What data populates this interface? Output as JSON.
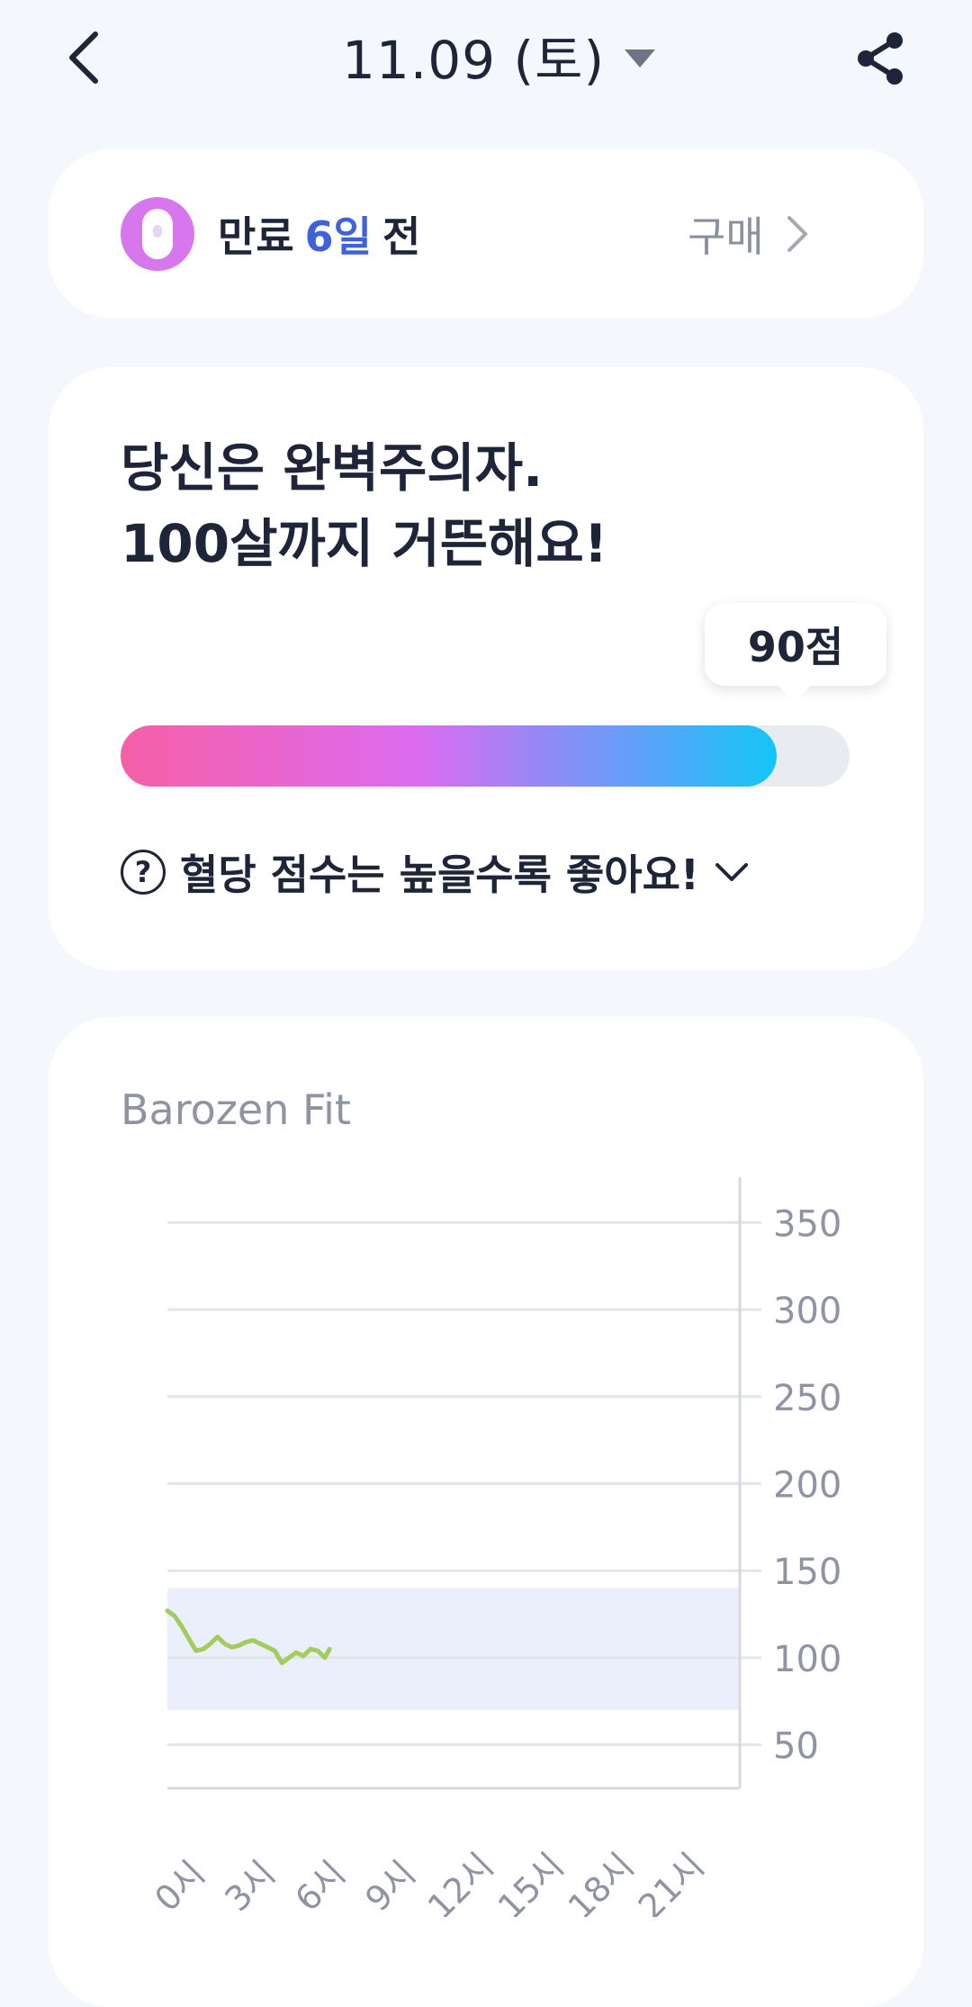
{
  "header": {
    "date": "11.09 (토)",
    "back_icon": "back-chevron-icon",
    "share_icon": "share-icon"
  },
  "expiry": {
    "prefix": "만료",
    "days": "6일",
    "suffix": "전",
    "buy_label": "구매",
    "icon": "pill-icon",
    "icon_color": "#d677ee"
  },
  "score": {
    "title_line1": "당신은 완벽주의자.",
    "title_line2": "100살까지 거뜬해요!",
    "value_label": "90점",
    "value": 90,
    "max": 100,
    "help_text": "혈당 점수는 높을수록 좋아요!",
    "gradient": [
      "#f65fa6",
      "#dd6bf0",
      "#5ba2fb",
      "#14c6f5"
    ]
  },
  "chart_data": {
    "type": "line",
    "title": "Barozen Fit",
    "x_tick_labels": [
      "0시",
      "3시",
      "6시",
      "9시",
      "12시",
      "15시",
      "18시",
      "21시"
    ],
    "y_ticks": [
      50,
      100,
      150,
      200,
      250,
      300,
      350
    ],
    "ylim": [
      25,
      375
    ],
    "xlim": [
      0,
      24
    ],
    "y_axis_position": "right",
    "grid": true,
    "target_range": [
      70,
      140
    ],
    "series": [
      {
        "color": "#a2cd5e",
        "x": [
          0,
          0.3,
          0.6,
          0.9,
          1.2,
          1.5,
          1.8,
          2.1,
          2.4,
          2.7,
          3.0,
          3.3,
          3.6,
          3.9,
          4.2,
          4.5,
          4.8,
          5.1,
          5.4,
          5.7,
          6.0,
          6.3,
          6.6,
          6.8
        ],
        "y": [
          127,
          124,
          118,
          111,
          104,
          105,
          108,
          112,
          108,
          106,
          107,
          109,
          110,
          108,
          106,
          104,
          97,
          100,
          103,
          101,
          105,
          104,
          100,
          105
        ]
      }
    ]
  }
}
